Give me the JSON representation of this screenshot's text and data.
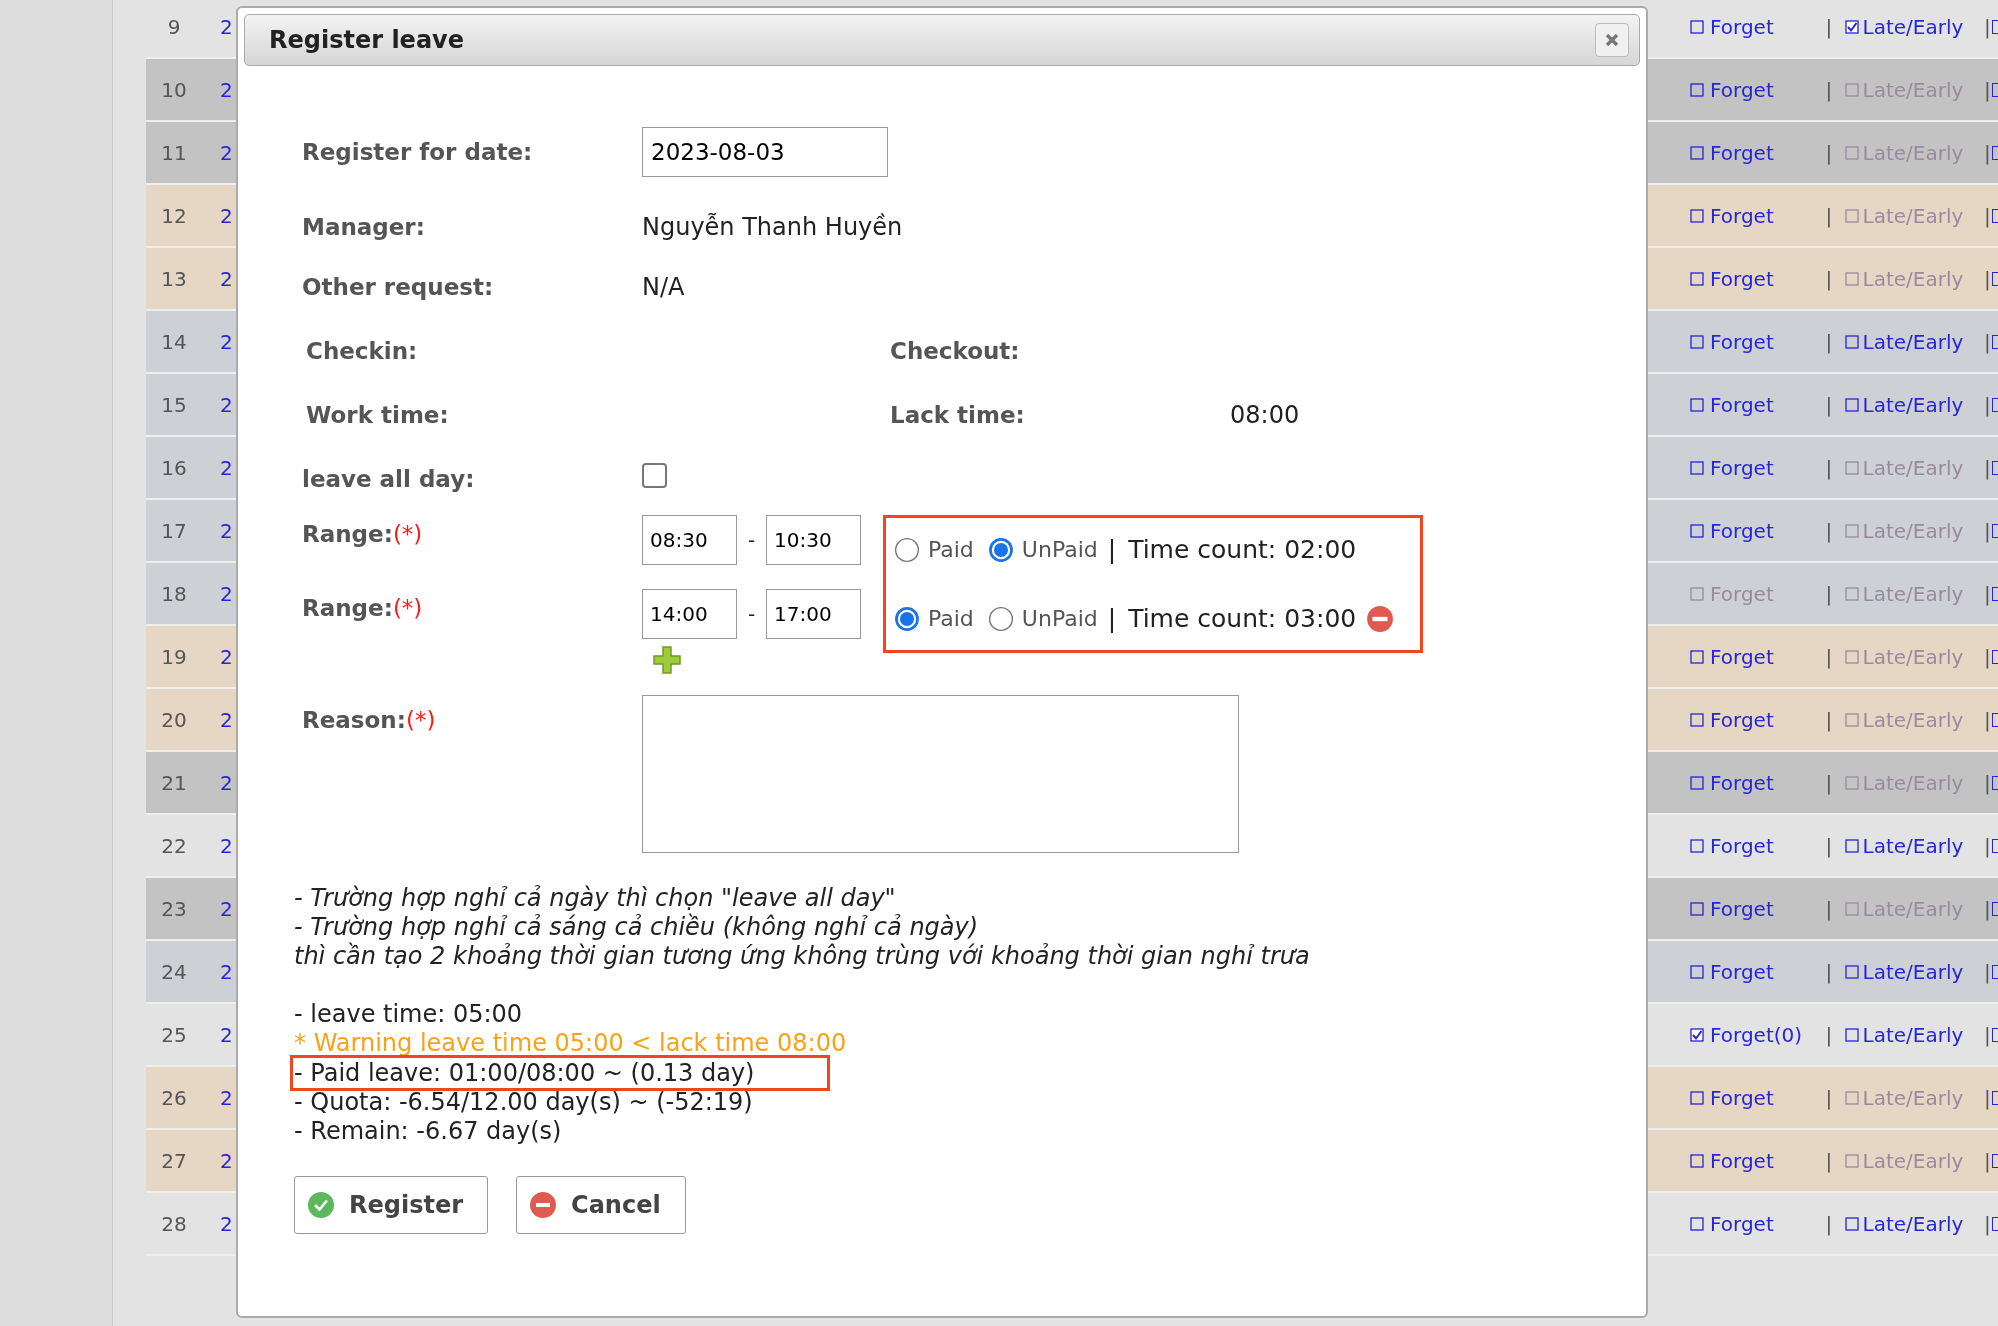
{
  "table": {
    "rows": [
      {
        "number": "9",
        "date": "2",
        "kind": "light",
        "forget": {
          "label": "Forget",
          "checked": false,
          "disabled": false
        },
        "separators": [
          "|",
          "|"
        ],
        "late_early": {
          "label": "Late/Early",
          "checked": true,
          "disabled": false
        }
      },
      {
        "number": "10",
        "date": "2",
        "kind": "dark",
        "forget": {
          "label": "Forget",
          "checked": false,
          "disabled": false
        },
        "separators": [
          "|",
          "|"
        ],
        "late_early": {
          "label": "Late/Early",
          "checked": false,
          "disabled": true
        }
      },
      {
        "number": "11",
        "date": "2",
        "kind": "dark",
        "forget": {
          "label": "Forget",
          "checked": false,
          "disabled": false
        },
        "separators": [
          "|",
          "|"
        ],
        "late_early": {
          "label": "Late/Early",
          "checked": false,
          "disabled": true
        }
      },
      {
        "number": "12",
        "date": "2",
        "kind": "beige",
        "forget": {
          "label": "Forget",
          "checked": false,
          "disabled": false
        },
        "separators": [
          "|",
          "|"
        ],
        "late_early": {
          "label": "Late/Early",
          "checked": false,
          "disabled": true
        }
      },
      {
        "number": "13",
        "date": "2",
        "kind": "beige",
        "forget": {
          "label": "Forget",
          "checked": false,
          "disabled": false
        },
        "separators": [
          "|",
          "|"
        ],
        "late_early": {
          "label": "Late/Early",
          "checked": false,
          "disabled": true
        }
      },
      {
        "number": "14",
        "date": "2",
        "kind": "slate",
        "forget": {
          "label": "Forget",
          "checked": false,
          "disabled": false
        },
        "separators": [
          "|",
          "|"
        ],
        "late_early": {
          "label": "Late/Early",
          "checked": false,
          "disabled": false
        }
      },
      {
        "number": "15",
        "date": "2",
        "kind": "slate",
        "forget": {
          "label": "Forget",
          "checked": false,
          "disabled": false
        },
        "separators": [
          "|",
          "|"
        ],
        "late_early": {
          "label": "Late/Early",
          "checked": false,
          "disabled": false
        }
      },
      {
        "number": "16",
        "date": "2",
        "kind": "slate",
        "forget": {
          "label": "Forget",
          "checked": false,
          "disabled": false
        },
        "separators": [
          "|",
          "|"
        ],
        "late_early": {
          "label": "Late/Early",
          "checked": false,
          "disabled": true
        }
      },
      {
        "number": "17",
        "date": "2",
        "kind": "slate",
        "forget": {
          "label": "Forget",
          "checked": false,
          "disabled": false
        },
        "separators": [
          "|",
          "|"
        ],
        "late_early": {
          "label": "Late/Early",
          "checked": false,
          "disabled": true
        }
      },
      {
        "number": "18",
        "date": "2",
        "kind": "slate",
        "forget": {
          "label": "Forget",
          "checked": false,
          "disabled": true
        },
        "separators": [
          "|",
          "|"
        ],
        "late_early": {
          "label": "Late/Early",
          "checked": false,
          "disabled": true
        }
      },
      {
        "number": "19",
        "date": "2",
        "kind": "beige",
        "forget": {
          "label": "Forget",
          "checked": false,
          "disabled": false
        },
        "separators": [
          "|",
          "|"
        ],
        "late_early": {
          "label": "Late/Early",
          "checked": false,
          "disabled": true
        }
      },
      {
        "number": "20",
        "date": "2",
        "kind": "beige",
        "forget": {
          "label": "Forget",
          "checked": false,
          "disabled": false
        },
        "separators": [
          "|",
          "|"
        ],
        "late_early": {
          "label": "Late/Early",
          "checked": false,
          "disabled": true
        }
      },
      {
        "number": "21",
        "date": "2",
        "kind": "dark",
        "forget": {
          "label": "Forget",
          "checked": false,
          "disabled": false
        },
        "separators": [
          "|",
          "|"
        ],
        "late_early": {
          "label": "Late/Early",
          "checked": false,
          "disabled": true
        }
      },
      {
        "number": "22",
        "date": "2",
        "kind": "light",
        "forget": {
          "label": "Forget",
          "checked": false,
          "disabled": false
        },
        "separators": [
          "|",
          "|"
        ],
        "late_early": {
          "label": "Late/Early",
          "checked": false,
          "disabled": false
        }
      },
      {
        "number": "23",
        "date": "2",
        "kind": "dark",
        "forget": {
          "label": "Forget",
          "checked": false,
          "disabled": false
        },
        "separators": [
          "|",
          "|"
        ],
        "late_early": {
          "label": "Late/Early",
          "checked": false,
          "disabled": true
        }
      },
      {
        "number": "24",
        "date": "2",
        "kind": "slate",
        "forget": {
          "label": "Forget",
          "checked": false,
          "disabled": false
        },
        "separators": [
          "|",
          "|"
        ],
        "late_early": {
          "label": "Late/Early",
          "checked": false,
          "disabled": false
        }
      },
      {
        "number": "25",
        "date": "2",
        "kind": "light",
        "forget": {
          "label": "Forget(0)",
          "checked": true,
          "disabled": false
        },
        "separators": [
          "|",
          "|"
        ],
        "late_early": {
          "label": "Late/Early",
          "checked": false,
          "disabled": false
        }
      },
      {
        "number": "26",
        "date": "2",
        "kind": "beige",
        "forget": {
          "label": "Forget",
          "checked": false,
          "disabled": false
        },
        "separators": [
          "|",
          "|"
        ],
        "late_early": {
          "label": "Late/Early",
          "checked": false,
          "disabled": true
        }
      },
      {
        "number": "27",
        "date": "2",
        "kind": "beige",
        "forget": {
          "label": "Forget",
          "checked": false,
          "disabled": false
        },
        "separators": [
          "|",
          "|"
        ],
        "late_early": {
          "label": "Late/Early",
          "checked": false,
          "disabled": true
        }
      },
      {
        "number": "28",
        "date": "2",
        "kind": "light",
        "forget": {
          "label": "Forget",
          "checked": false,
          "disabled": false
        },
        "separators": [
          "|",
          "|"
        ],
        "late_early": {
          "label": "Late/Early",
          "checked": false,
          "disabled": false
        }
      }
    ]
  },
  "dialog": {
    "title": "Register leave",
    "register_date": {
      "label": "Register for date:",
      "value": "2023-08-03"
    },
    "manager": {
      "label": "Manager:",
      "value": "Nguyễn Thanh Huyền"
    },
    "other_request": {
      "label": "Other request:",
      "value": "N/A"
    },
    "checkin": {
      "label": "Checkin:"
    },
    "checkout": {
      "label": "Checkout:"
    },
    "work_time": {
      "label": "Work time:"
    },
    "lack_time": {
      "label": "Lack time:",
      "value": "08:00"
    },
    "leave_all_day": {
      "label": "leave all day:",
      "checked": false
    },
    "ranges": [
      {
        "label": "Range:",
        "required": "(*)",
        "from": "08:30",
        "dash": "-",
        "to": "10:30",
        "options": [
          {
            "label": "Paid",
            "selected": false
          },
          {
            "label": "UnPaid",
            "selected": true
          }
        ],
        "separator": "|",
        "time_count": "Time count: 02:00",
        "removable": false
      },
      {
        "label": "Range:",
        "required": "(*)",
        "from": "14:00",
        "dash": "-",
        "to": "17:00",
        "options": [
          {
            "label": "Paid",
            "selected": true
          },
          {
            "label": "UnPaid",
            "selected": false
          }
        ],
        "separator": "|",
        "time_count": "Time count: 03:00",
        "removable": true
      }
    ],
    "reason": {
      "label": "Reason:",
      "required": "(*)"
    },
    "notes": [
      "- Trường hợp nghỉ cả ngày thì chọn \"leave all day\"",
      "- Trường hợp nghỉ cả sáng cả chiều (không nghỉ cả ngày)",
      "thì cần tạo 2 khoảng thời gian tương ứng không trùng với khoảng thời gian nghỉ trưa"
    ],
    "summary": [
      {
        "kind": "plain",
        "text": "- leave time: 05:00"
      },
      {
        "kind": "warning",
        "text": "* Warning leave time 05:00 < lack time 08:00"
      },
      {
        "kind": "highlighted",
        "text": "- Paid leave: 01:00/08:00 ~ (0.13 day)"
      },
      {
        "kind": "plain",
        "text": "- Quota: -6.54/12.00 day(s) ~ (-52:19)"
      },
      {
        "kind": "plain",
        "text": "- Remain: -6.67 day(s)"
      }
    ],
    "buttons": [
      {
        "label": "Register",
        "kind": "confirm"
      },
      {
        "label": "Cancel",
        "kind": "cancel"
      }
    ]
  }
}
